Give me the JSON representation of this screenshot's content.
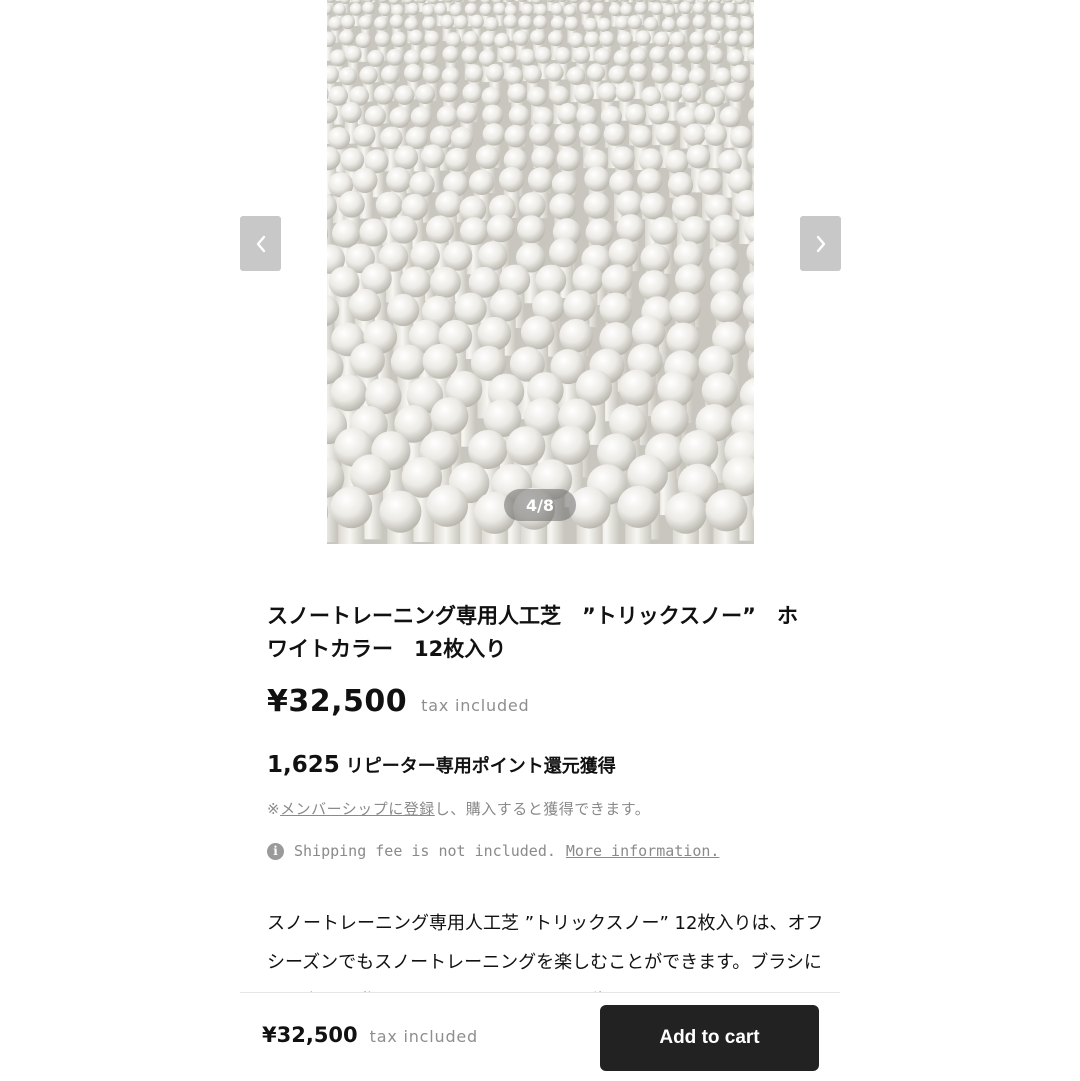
{
  "gallery": {
    "counter": "4/8",
    "image_subject": "white plastic artificial snow turf bristles",
    "prev_icon": "chevron-left-icon",
    "next_icon": "chevron-right-icon"
  },
  "product": {
    "title": "スノートレーニング専用人工芝　”トリックスノー”　ホワイトカラー　12枚入り",
    "price": "¥32,500",
    "tax_label": "tax included",
    "points": "1,625",
    "points_label": "リピーター専用ポイント還元獲得",
    "member_prefix": "※",
    "member_link": "メンバーシップに登録",
    "member_suffix": "し、購入すると獲得できます。",
    "shipping_text": "Shipping fee is not included.",
    "shipping_link": "More information.",
    "shipping_icon": "info-icon",
    "description": "スノートレーニング専用人工芝 ”トリックスノー” 12枚入りは、オフシーズンでもスノートレーニングを楽しむことができます。ブラシには雪上での動きをよりリアルに再現する為、ヒールと同"
  },
  "cart_bar": {
    "price": "¥32,500",
    "tax_label": "tax included",
    "button_label": "Add to cart"
  },
  "colors": {
    "button_bg": "#222222",
    "muted_text": "#8a8a8a",
    "nav_button_bg": "#c8c8c8"
  }
}
